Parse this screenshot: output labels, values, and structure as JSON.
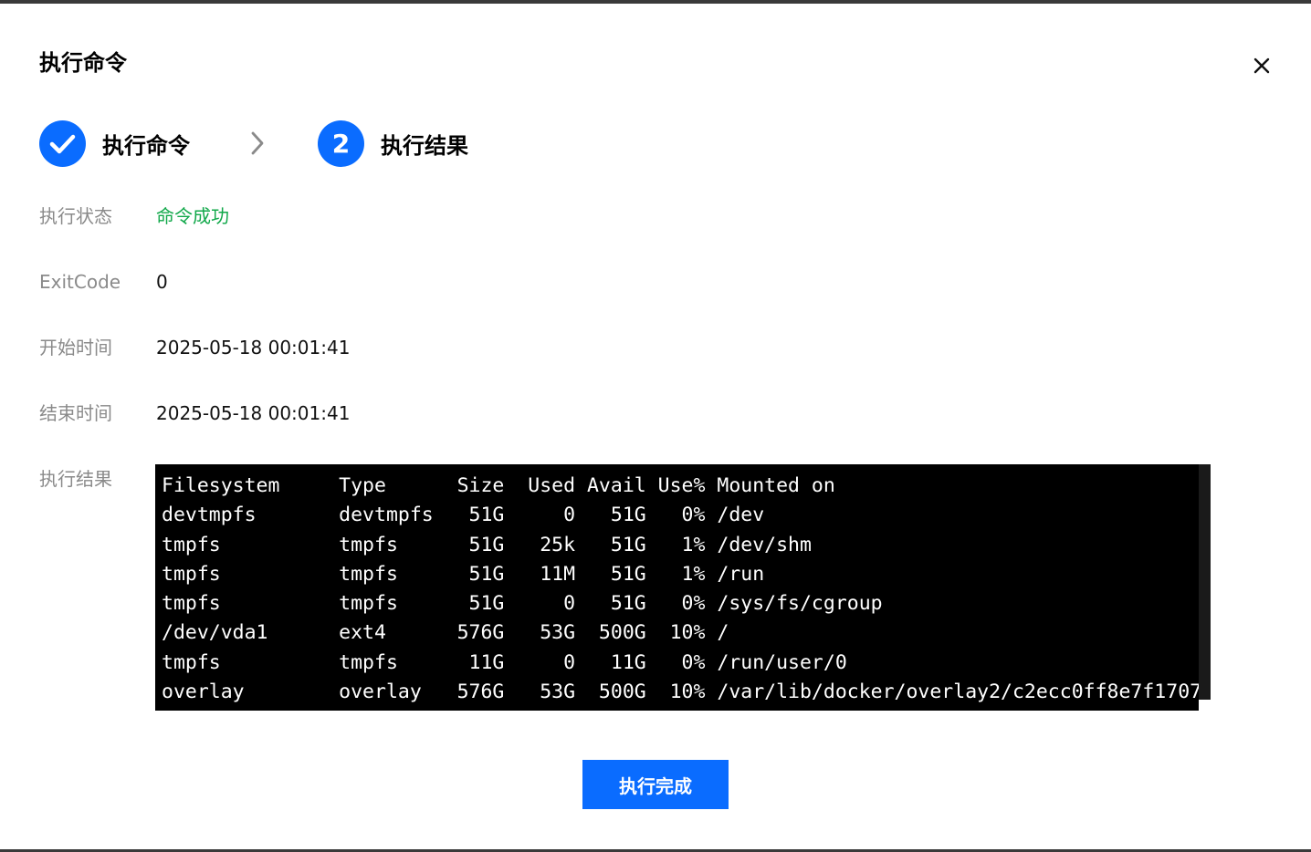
{
  "dialog": {
    "title": "执行命令"
  },
  "steps": [
    {
      "label": "执行命令",
      "status": "done"
    },
    {
      "number": "2",
      "label": "执行结果",
      "status": "active"
    }
  ],
  "details": {
    "status_label": "执行状态",
    "status_value": "命令成功",
    "exitcode_label": "ExitCode",
    "exitcode_value": "0",
    "start_label": "开始时间",
    "start_value": "2025-05-18 00:01:41",
    "end_label": "结束时间",
    "end_value": "2025-05-18 00:01:41",
    "result_label": "执行结果"
  },
  "terminal": {
    "lines": [
      "Filesystem     Type      Size  Used Avail Use% Mounted on",
      "devtmpfs       devtmpfs   51G     0   51G   0% /dev",
      "tmpfs          tmpfs      51G   25k   51G   1% /dev/shm",
      "tmpfs          tmpfs      51G   11M   51G   1% /run",
      "tmpfs          tmpfs      51G     0   51G   0% /sys/fs/cgroup",
      "/dev/vda1      ext4      576G   53G  500G  10% /",
      "tmpfs          tmpfs      11G     0   11G   0% /run/user/0",
      "overlay        overlay   576G   53G  500G  10% /var/lib/docker/overlay2/c2ecc0ff8e7f1707"
    ]
  },
  "footer": {
    "done_button": "执行完成"
  },
  "colors": {
    "primary": "#0a6cff",
    "success": "#11a84a",
    "label_gray": "#8a8a8a",
    "terminal_bg": "#000000"
  }
}
